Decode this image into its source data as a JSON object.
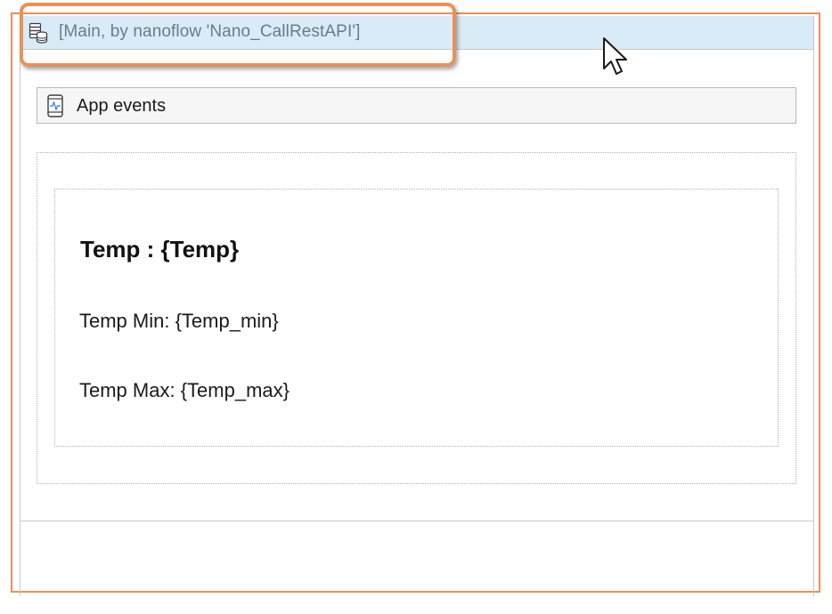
{
  "dataview": {
    "header_title": "[Main, by nanoflow 'Nano_CallRestAPI']",
    "header_icon": "database-icon"
  },
  "app_events": {
    "label": "App events",
    "icon": "mobile-phone-icon"
  },
  "content": {
    "heading": "Temp : {Temp}",
    "temp_min": "Temp Min: {Temp_min}",
    "temp_max": "Temp Max: {Temp_max}"
  },
  "colors": {
    "highlight": "#e8915a",
    "header_background": "#d9ebf7",
    "header_text": "#6f7a85"
  }
}
